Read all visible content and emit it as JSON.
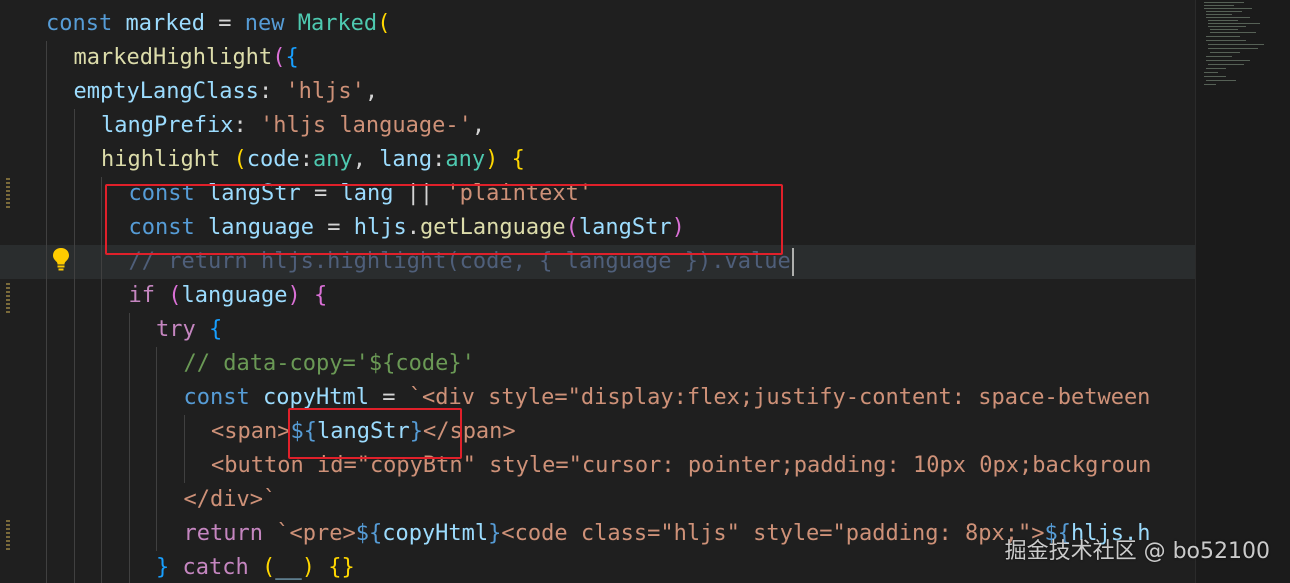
{
  "editor": {
    "language": "javascript",
    "active_line_index": 7,
    "lines": [
      {
        "indent": 0,
        "tokens": [
          [
            "const ",
            "kb"
          ],
          [
            "marked",
            "v"
          ],
          [
            " = ",
            "op"
          ],
          [
            "new ",
            "kb"
          ],
          [
            "Marked",
            "c"
          ],
          [
            "(",
            "p1"
          ]
        ]
      },
      {
        "indent": 1,
        "tokens": [
          [
            "markedHighlight",
            "f"
          ],
          [
            "(",
            "p2"
          ],
          [
            "{",
            "p3"
          ]
        ]
      },
      {
        "indent": 1,
        "tokens": [
          [
            "emptyLangClass",
            "v"
          ],
          [
            ": ",
            "op"
          ],
          [
            "'hljs'",
            "s"
          ],
          [
            ",",
            "op"
          ]
        ]
      },
      {
        "indent": 2,
        "tokens": [
          [
            "langPrefix",
            "v"
          ],
          [
            ": ",
            "op"
          ],
          [
            "'hljs language-'",
            "s"
          ],
          [
            ",",
            "op"
          ]
        ]
      },
      {
        "indent": 2,
        "tokens": [
          [
            "highlight ",
            "f"
          ],
          [
            "(",
            "p1"
          ],
          [
            "code",
            "v"
          ],
          [
            ":",
            "op"
          ],
          [
            "any",
            "c"
          ],
          [
            ", ",
            "op"
          ],
          [
            "lang",
            "v"
          ],
          [
            ":",
            "op"
          ],
          [
            "any",
            "c"
          ],
          [
            ") ",
            "p1"
          ],
          [
            "{",
            "p1"
          ]
        ]
      },
      {
        "indent": 3,
        "tokens": [
          [
            "const ",
            "kb"
          ],
          [
            "langStr",
            "v"
          ],
          [
            " = ",
            "op"
          ],
          [
            "lang",
            "v"
          ],
          [
            " || ",
            "op"
          ],
          [
            "'plaintext'",
            "s"
          ]
        ]
      },
      {
        "indent": 3,
        "tokens": [
          [
            "const ",
            "kb"
          ],
          [
            "language",
            "v"
          ],
          [
            " = ",
            "op"
          ],
          [
            "hljs",
            "v"
          ],
          [
            ".",
            "op"
          ],
          [
            "getLanguage",
            "f"
          ],
          [
            "(",
            "p2"
          ],
          [
            "langStr",
            "v"
          ],
          [
            ")",
            "p2"
          ]
        ]
      },
      {
        "indent": 3,
        "tokens": [
          [
            "// return hljs.highlight(code, { language }).value",
            "cmdim"
          ]
        ]
      },
      {
        "indent": 3,
        "tokens": [
          [
            "if ",
            "k"
          ],
          [
            "(",
            "p2"
          ],
          [
            "language",
            "v"
          ],
          [
            ") ",
            "p2"
          ],
          [
            "{",
            "p2"
          ]
        ]
      },
      {
        "indent": 4,
        "tokens": [
          [
            "try ",
            "k"
          ],
          [
            "{",
            "p3"
          ]
        ]
      },
      {
        "indent": 5,
        "tokens": [
          [
            "// data-copy='${code}'",
            "cm"
          ]
        ]
      },
      {
        "indent": 5,
        "tokens": [
          [
            "const ",
            "kb"
          ],
          [
            "copyHtml",
            "v"
          ],
          [
            " = ",
            "op"
          ],
          [
            "`<div style=\"display:flex;justify-content: space-between",
            "s"
          ]
        ]
      },
      {
        "indent": 6,
        "tokens": [
          [
            "<span>",
            "s"
          ],
          [
            "${",
            "tl"
          ],
          [
            "langStr",
            "v"
          ],
          [
            "}",
            "tl"
          ],
          [
            "</span>",
            "s"
          ]
        ]
      },
      {
        "indent": 6,
        "tokens": [
          [
            "<button id=\"copyBtn\" style=\"cursor: pointer;padding: 10px 0px;backgroun",
            "s"
          ]
        ]
      },
      {
        "indent": 5,
        "tokens": [
          [
            "</div>`",
            "s"
          ]
        ]
      },
      {
        "indent": 5,
        "tokens": [
          [
            "return ",
            "k"
          ],
          [
            "`<pre>",
            "s"
          ],
          [
            "${",
            "tl"
          ],
          [
            "copyHtml",
            "v"
          ],
          [
            "}",
            "tl"
          ],
          [
            "<code class=\"hljs\" style=\"padding: 8px;\">",
            "s"
          ],
          [
            "${",
            "tl"
          ],
          [
            "hljs.h",
            "v"
          ]
        ]
      },
      {
        "indent": 4,
        "tokens": [
          [
            "} ",
            "p3"
          ],
          [
            "catch ",
            "k"
          ],
          [
            "(",
            "p1"
          ],
          [
            "__",
            "v"
          ],
          [
            ") ",
            "p1"
          ],
          [
            "{}",
            "p1"
          ]
        ]
      }
    ]
  },
  "watermark": "掘金技术社区 @ bo52100",
  "colors": {
    "background": "#1f1f1f",
    "highlight_box": "#e0202a",
    "active_line": "#2a2d2e"
  }
}
